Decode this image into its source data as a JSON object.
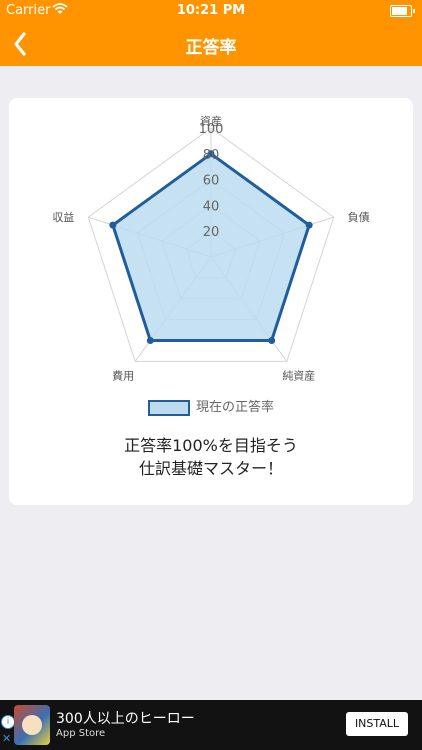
{
  "status_bar": {
    "carrier": "Carrier",
    "time": "10:21 PM",
    "battery_level": 0.9
  },
  "nav": {
    "title": "正答率"
  },
  "chart_data": {
    "type": "radar",
    "axes": [
      "資産",
      "負債",
      "純資産",
      "費用",
      "収益"
    ],
    "ticks": [
      "20",
      "40",
      "60",
      "80",
      "100"
    ],
    "range": [
      0,
      100
    ],
    "series": [
      {
        "name": "現在の正答率",
        "values": [
          80,
          80,
          80,
          80,
          80
        ]
      }
    ],
    "colors": {
      "line": "#1f5e9b",
      "fill": "#bcdcee",
      "grid": "#d4d4d4"
    }
  },
  "message": {
    "line1": "正答率100%を目指そう",
    "line2": "仕訳基礎マスター！"
  },
  "ad": {
    "title": "300人以上のヒーロー",
    "store": "App Store",
    "install": "INSTALL"
  }
}
